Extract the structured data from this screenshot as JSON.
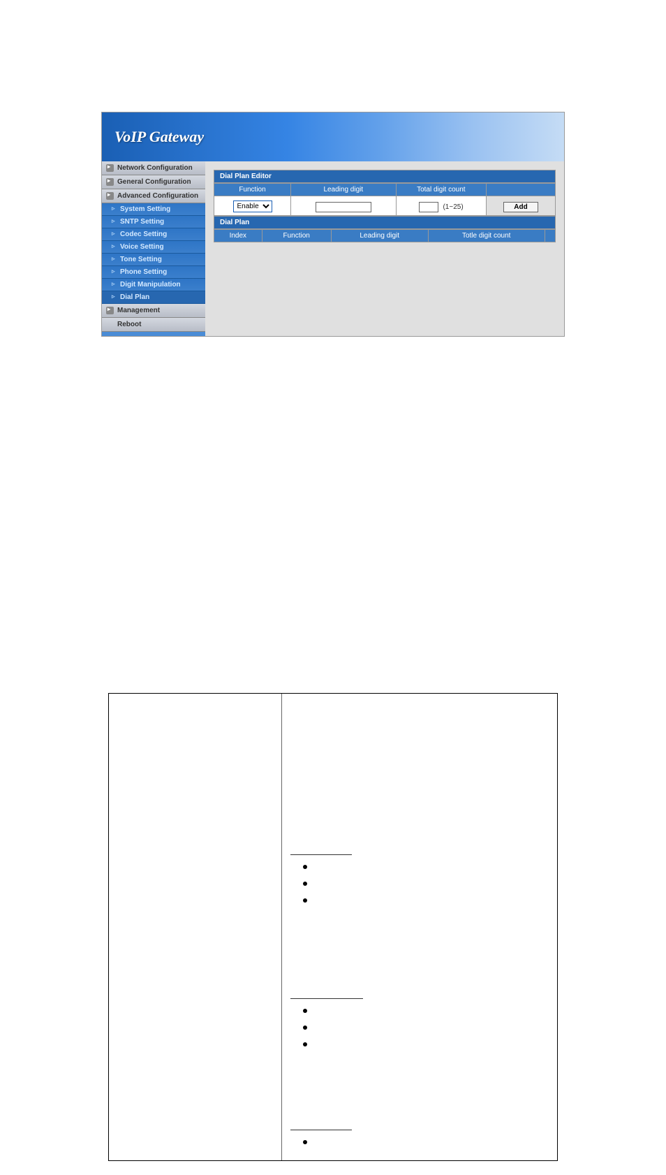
{
  "header": {
    "logo": "VoIP Gateway"
  },
  "sidebar": {
    "sections": [
      {
        "label": "Network Configuration",
        "type": "section"
      },
      {
        "label": "General Configuration",
        "type": "section"
      },
      {
        "label": "Advanced Configuration",
        "type": "section"
      },
      {
        "label": "System Setting",
        "type": "item"
      },
      {
        "label": "SNTP Setting",
        "type": "item"
      },
      {
        "label": "Codec Setting",
        "type": "item"
      },
      {
        "label": "Voice Setting",
        "type": "item"
      },
      {
        "label": "Tone Setting",
        "type": "item"
      },
      {
        "label": "Phone Setting",
        "type": "item"
      },
      {
        "label": "Digit Manipulation",
        "type": "item"
      },
      {
        "label": "Dial Plan",
        "type": "item",
        "active": true
      },
      {
        "label": "Management",
        "type": "section"
      },
      {
        "label": "Reboot",
        "type": "plain"
      }
    ]
  },
  "editor": {
    "title": "Dial Plan Editor",
    "columns": {
      "function": "Function",
      "leading": "Leading digit",
      "total": "Total digit count"
    },
    "function_select": "Enable",
    "leading_value": "",
    "count_value": "",
    "count_range": "(1~25)",
    "add_label": "Add"
  },
  "list": {
    "title": "Dial Plan",
    "columns": {
      "index": "Index",
      "function": "Function",
      "leading": "Leading digit",
      "total": "Totle digit count"
    }
  }
}
